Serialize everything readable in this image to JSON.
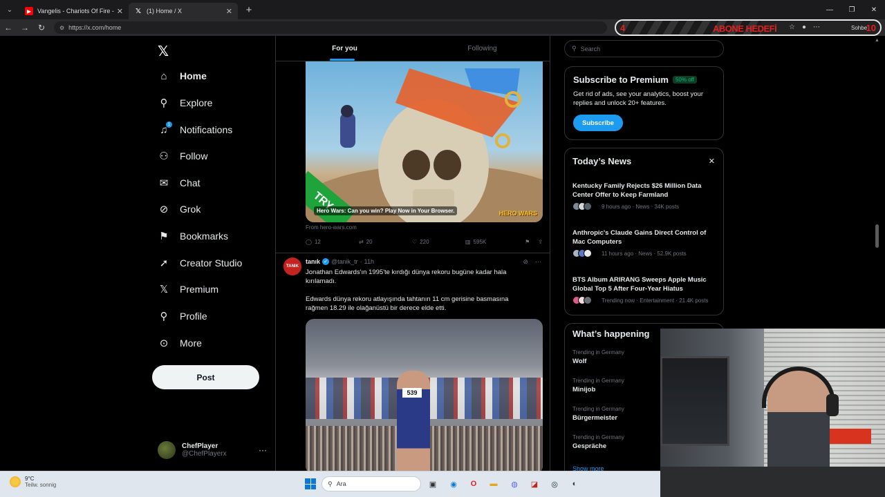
{
  "browser": {
    "tabs": [
      {
        "title": "Vangelis - Chariots Of Fire - YouTu",
        "icon": "youtube-icon"
      },
      {
        "title": "(1) Home / X",
        "icon": "x-icon"
      }
    ],
    "url": "https://x.com/home",
    "overlay": {
      "left_number": "4",
      "right_number": "10",
      "banner": "ABONE HEDEFİ",
      "copilot_label": "Sohbe"
    }
  },
  "nav": {
    "items": [
      {
        "label": "Home",
        "icon": "home-icon"
      },
      {
        "label": "Explore",
        "icon": "search-icon"
      },
      {
        "label": "Notifications",
        "icon": "bell-icon",
        "badge": "1"
      },
      {
        "label": "Follow",
        "icon": "person-plus-icon"
      },
      {
        "label": "Chat",
        "icon": "mail-icon"
      },
      {
        "label": "Grok",
        "icon": "grok-icon"
      },
      {
        "label": "Bookmarks",
        "icon": "bookmark-icon"
      },
      {
        "label": "Creator Studio",
        "icon": "rocket-icon"
      },
      {
        "label": "Premium",
        "icon": "x-icon"
      },
      {
        "label": "Profile",
        "icon": "person-icon"
      },
      {
        "label": "More",
        "icon": "more-circle-icon"
      }
    ],
    "post_label": "Post",
    "profile": {
      "name": "ChefPlayer",
      "handle": "@ChefPlayerx"
    }
  },
  "timeline": {
    "tabs": [
      "For you",
      "Following"
    ],
    "ad": {
      "caption": "Hero Wars: Can you win? Play Now in Your Browser.",
      "brand": "HERO WARS",
      "try_label": "TRY",
      "from": "From hero-wars.com",
      "replies": "12",
      "reposts": "20",
      "likes": "220",
      "views": "595K"
    },
    "tweet": {
      "name": "tanık",
      "handle": "@tanik_tr",
      "time": "11h",
      "avatar_text": "TANIK",
      "text1": "Jonathan Edwards'ın 1995'te kırdığı dünya rekoru bugüne kadar hala kırılamadı.",
      "text2": "Edwards dünya rekoru atlayışında tahtanın 11 cm gerisine basmasına rağmen 18.29 ile olağanüstü bir derece elde etti.",
      "bib": "539"
    }
  },
  "right": {
    "search_placeholder": "Search",
    "premium": {
      "title": "Subscribe to Premium",
      "badge": "50% off",
      "desc": "Get rid of ads, see your analytics, boost your replies and unlock 20+ features.",
      "button": "Subscribe"
    },
    "news": {
      "title": "Today’s News",
      "items": [
        {
          "headline": "Kentucky Family Rejects $26 Million Data Center Offer to Keep Farmland",
          "meta": "9 hours ago · News · 34K posts"
        },
        {
          "headline": "Anthropic's Claude Gains Direct Control of Mac Computers",
          "meta": "11 hours ago · News · 52.9K posts"
        },
        {
          "headline": "BTS Album ARIRANG Sweeps Apple Music Global Top 5 After Four-Year Hiatus",
          "meta": "Trending now · Entertainment · 21.4K posts"
        }
      ]
    },
    "happening": {
      "title": "What’s happening",
      "trends": [
        {
          "context": "Trending in Germany",
          "name": "Wolf"
        },
        {
          "context": "Trending in Germany",
          "name": "Minijob"
        },
        {
          "context": "Trending in Germany",
          "name": "Bürgermeister"
        },
        {
          "context": "Trending in Germany",
          "name": "Gespräche"
        }
      ],
      "show_more": "Show more"
    }
  },
  "taskbar": {
    "temp": "9°C",
    "condition": "Teilw. sonnig",
    "search_placeholder": "Ara"
  },
  "colors": {
    "accent": "#1d9bf0",
    "background": "#000000",
    "border": "#2f3336",
    "muted": "#71767b",
    "overlay_red": "#e02020"
  }
}
